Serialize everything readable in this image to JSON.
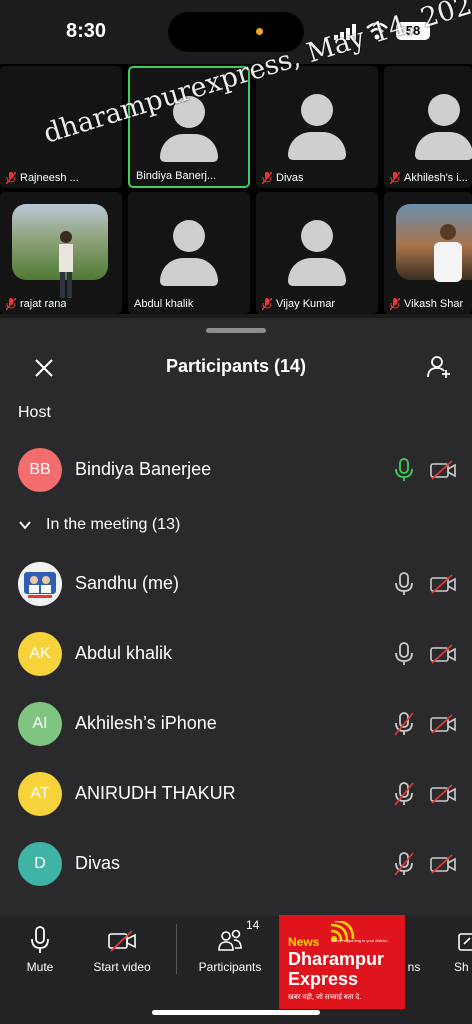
{
  "status_bar": {
    "time": "8:30",
    "battery": "58"
  },
  "watermark": "dharampurexpress, May 14, 202",
  "video_tiles": [
    {
      "label": "Rajneesh ...",
      "muted": true,
      "type": "dark"
    },
    {
      "label": "Bindiya Banerj...",
      "muted": false,
      "type": "avatar",
      "active": true
    },
    {
      "label": "Divas",
      "muted": true,
      "type": "avatar"
    },
    {
      "label": "Akhilesh's i...",
      "muted": true,
      "type": "avatar"
    },
    {
      "label": "rajat rana",
      "muted": true,
      "type": "photo"
    },
    {
      "label": "Abdul khalik",
      "muted": false,
      "type": "avatar"
    },
    {
      "label": "Vijay Kumar",
      "muted": true,
      "type": "avatar"
    },
    {
      "label": "Vikash Shar",
      "muted": true,
      "type": "photo"
    }
  ],
  "sheet": {
    "title": "Participants (14)",
    "host_section": "Host",
    "meeting_section": "In the meeting (13)"
  },
  "host": {
    "initials": "BB",
    "name": "Bindiya Banerjee",
    "color": "#f26d6d",
    "mic": "on-green",
    "video": "off"
  },
  "participants": [
    {
      "initials": "",
      "name": "Sandhu (me)",
      "color": "#ffffff",
      "mic": "on",
      "video": "off"
    },
    {
      "initials": "AK",
      "name": "Abdul khalik",
      "color": "#f7d33b",
      "mic": "on",
      "video": "off"
    },
    {
      "initials": "AI",
      "name": "Akhilesh’s iPhone",
      "color": "#7fc481",
      "mic": "muted",
      "video": "off"
    },
    {
      "initials": "AT",
      "name": "ANIRUDH THAKUR",
      "color": "#f7d33b",
      "mic": "muted",
      "video": "off"
    },
    {
      "initials": "D",
      "name": "Divas",
      "color": "#3fb3a5",
      "mic": "muted",
      "video": "off"
    }
  ],
  "toolbar": {
    "mute": "Mute",
    "start_video": "Start video",
    "participants": "Participants",
    "participants_count": "14",
    "more_partial": "ns",
    "share_partial": "Sh"
  },
  "news_logo": {
    "top": "News",
    "tiny": "Every happening in your district...",
    "line1": "Dharampur",
    "line2": "Express",
    "tagline": "खबर वही, जो सच्चाई बता दे."
  }
}
